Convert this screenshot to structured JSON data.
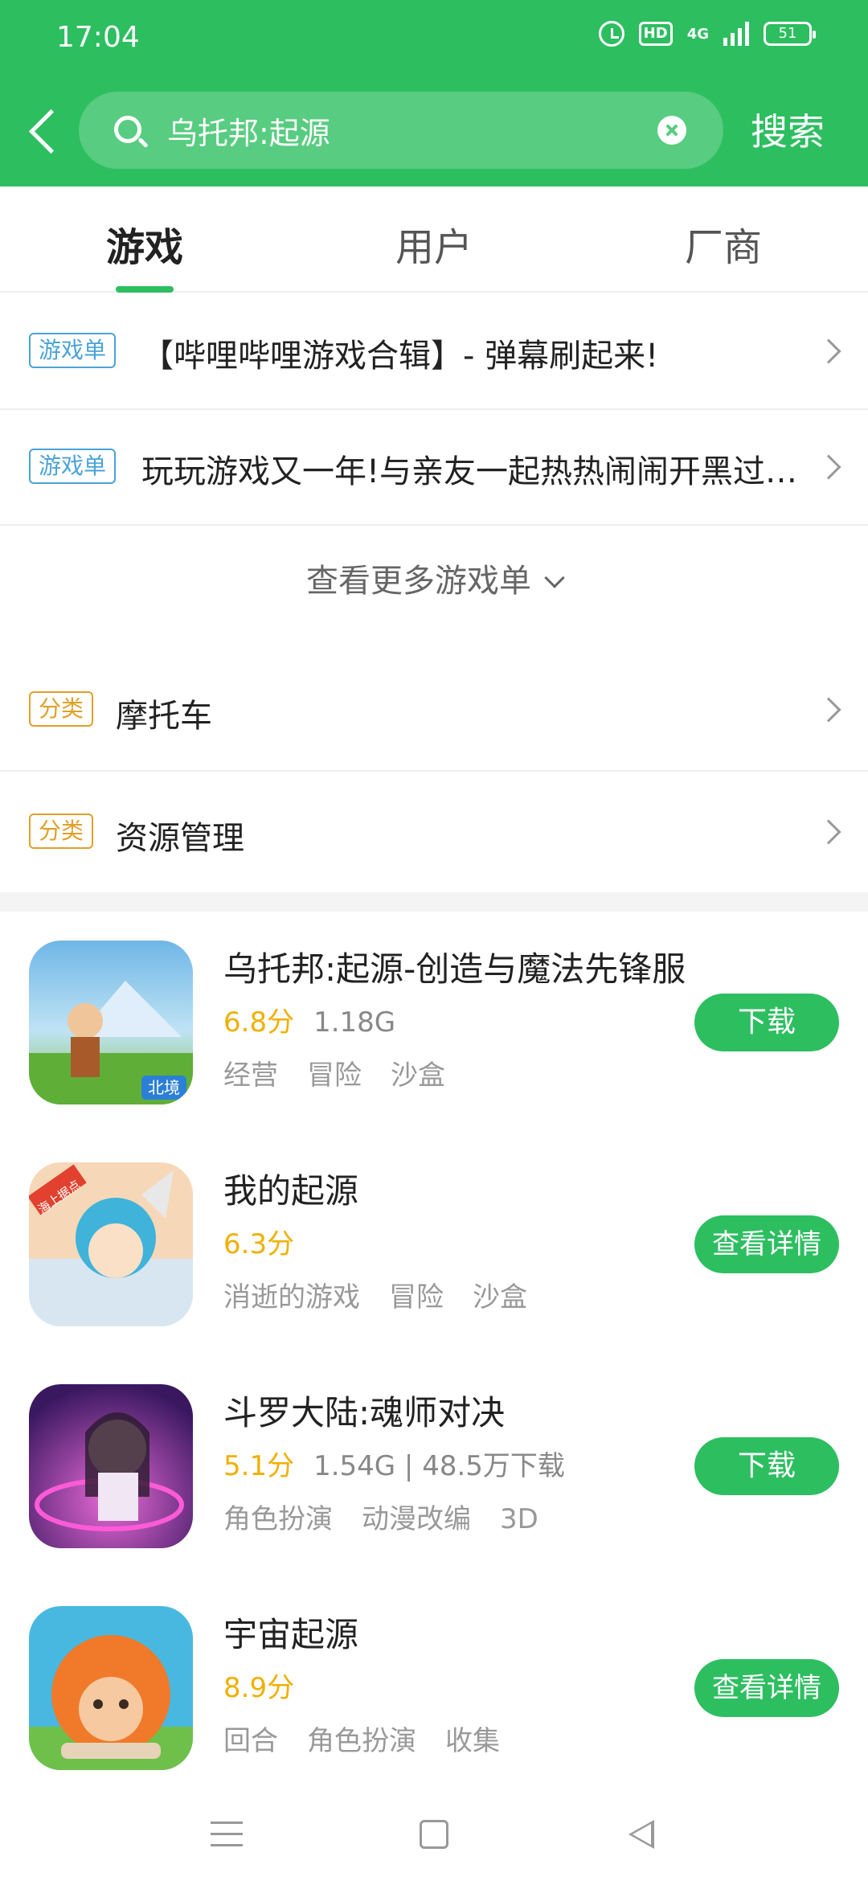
{
  "status_bar": {
    "time": "17:04",
    "hd": "HD",
    "network": "4G",
    "battery": "51"
  },
  "search": {
    "query": "乌托邦:起源",
    "button_label": "搜索"
  },
  "tabs": [
    {
      "label": "游戏",
      "active": true
    },
    {
      "label": "用户",
      "active": false
    },
    {
      "label": "厂商",
      "active": false
    }
  ],
  "collections": [
    {
      "badge": "游戏单",
      "title": "【哔哩哔哩游戏合辑】- 弹幕刷起来!"
    },
    {
      "badge": "游戏单",
      "title": "玩玩游戏又一年!与亲友一起热热闹闹开黑过大年"
    }
  ],
  "more_collections": "查看更多游戏单",
  "categories": [
    {
      "badge": "分类",
      "title": "摩托车"
    },
    {
      "badge": "分类",
      "title": "资源管理"
    }
  ],
  "games": [
    {
      "title": "乌托邦:起源-创造与魔法先锋服",
      "score": "6.8分",
      "meta": "1.18G",
      "tags": [
        "经营",
        "冒险",
        "沙盒"
      ],
      "button": "下载",
      "icon_badge": "北境"
    },
    {
      "title": "我的起源",
      "score": "6.3分",
      "meta": "",
      "tags": [
        "消逝的游戏",
        "冒险",
        "沙盒"
      ],
      "button": "查看详情",
      "icon_badge": "海上据点"
    },
    {
      "title": "斗罗大陆:魂师对决",
      "score": "5.1分",
      "meta": "1.54G | 48.5万下载",
      "tags": [
        "角色扮演",
        "动漫改编",
        "3D"
      ],
      "button": "下载"
    },
    {
      "title": "宇宙起源",
      "score": "8.9分",
      "meta": "",
      "tags": [
        "回合",
        "角色扮演",
        "收集"
      ],
      "button": "查看详情"
    }
  ],
  "colors": {
    "brand_green": "#2dbe60",
    "score_yellow": "#f0b000",
    "badge_blue": "#4aa3d8",
    "badge_orange": "#e0a028"
  }
}
